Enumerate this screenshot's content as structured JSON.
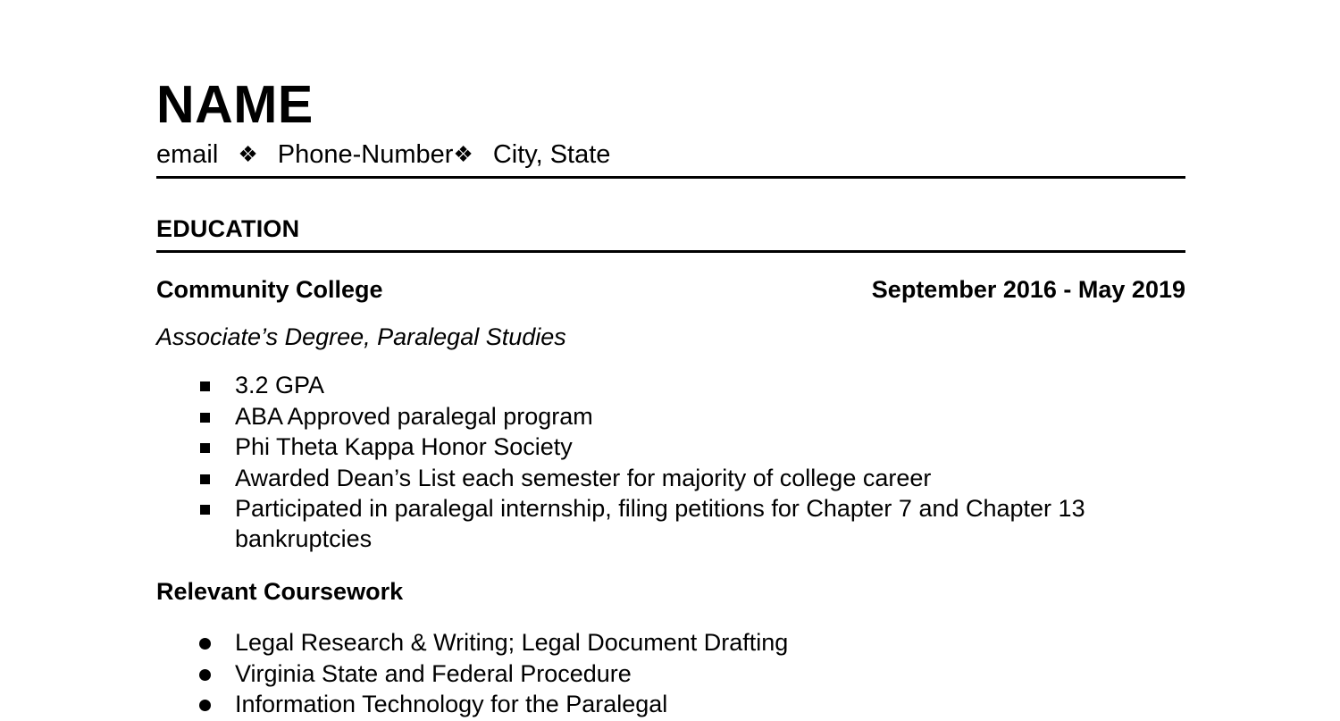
{
  "document": {
    "type": "resume",
    "header": {
      "name": "NAME",
      "contact": {
        "email": "email",
        "separator": "❖",
        "phone": "Phone-Number",
        "location": "City, State"
      }
    },
    "sections": [
      {
        "title": "EDUCATION",
        "entries": [
          {
            "institution": "Community College",
            "dates": "September 2016 - May 2019",
            "degree": "Associate’s Degree, Paralegal Studies",
            "highlights": [
              "3.2 GPA",
              "ABA Approved paralegal program",
              "Phi Theta Kappa Honor Society",
              "Awarded Dean’s List each semester for majority of college career",
              "Participated in paralegal internship, filing petitions for Chapter 7 and Chapter 13 bankruptcies"
            ],
            "subsection": {
              "title": "Relevant Coursework",
              "items": [
                "Legal Research & Writing; Legal Document Drafting",
                "Virginia State and Federal Procedure",
                "Information Technology for the Paralegal"
              ]
            }
          }
        ]
      }
    ]
  },
  "colors": {
    "text": "#000000",
    "background": "#ffffff",
    "rule": "#000000"
  }
}
